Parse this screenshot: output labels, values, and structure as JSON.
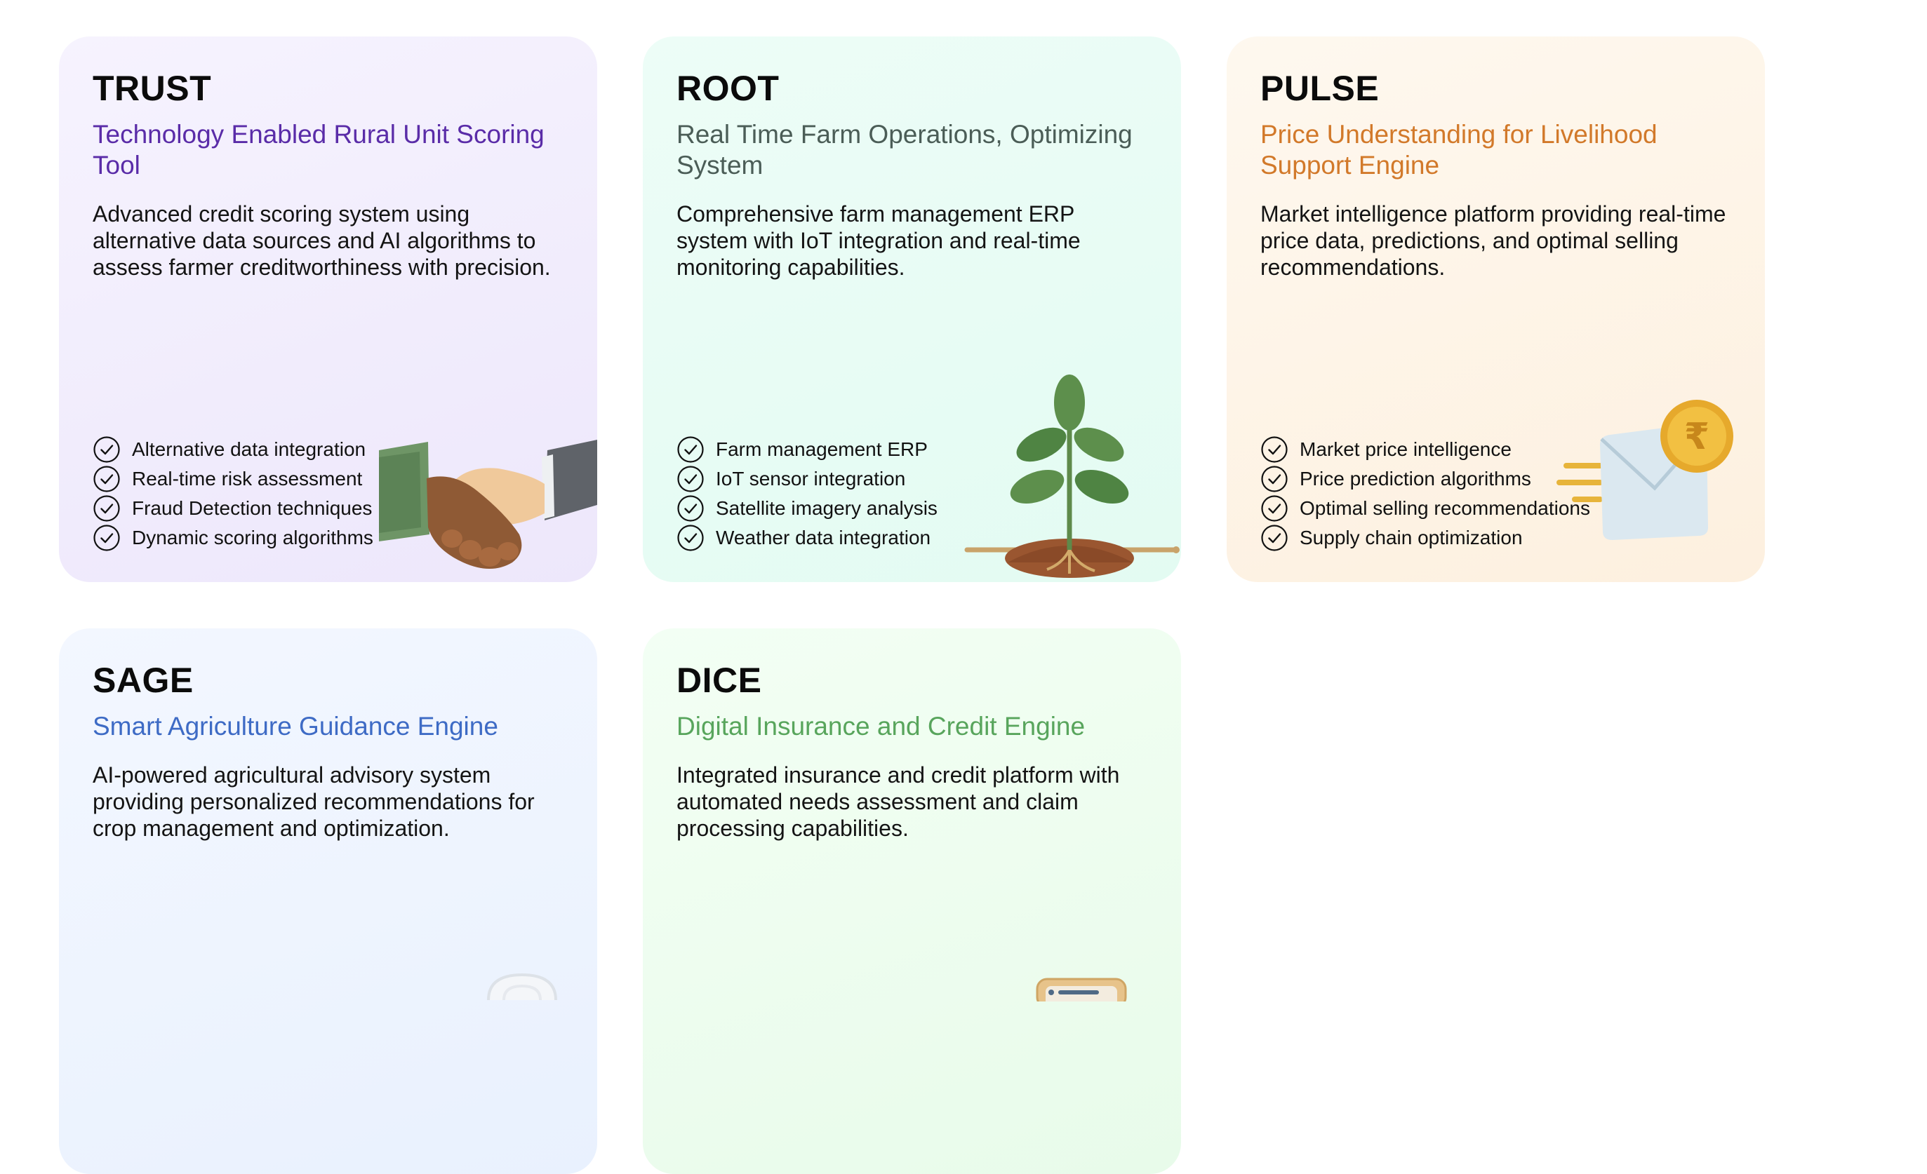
{
  "cards": [
    {
      "title": "TRUST",
      "subtitle": "Technology Enabled Rural Unit Scoring Tool",
      "subtitle_color": "#5a2ca8",
      "description": "Advanced credit scoring system using alternative data sources and AI algorithms to assess farmer creditworthiness with precision.",
      "features": [
        "Alternative data integration",
        "Real-time risk assessment",
        "Fraud Detection techniques",
        "Dynamic scoring algorithms"
      ],
      "icon": "handshake-icon"
    },
    {
      "title": "ROOT",
      "subtitle": "Real Time Farm Operations, Optimizing System",
      "subtitle_color": "#4b5d57",
      "description": "Comprehensive farm management ERP system with IoT integration and real-time monitoring capabilities.",
      "features": [
        "Farm management ERP",
        "IoT sensor integration",
        "Satellite imagery analysis",
        "Weather data integration"
      ],
      "icon": "sprout-icon"
    },
    {
      "title": "PULSE",
      "subtitle": "Price Understanding for Livelihood Support Engine",
      "subtitle_color": "#d2792a",
      "description": "Market intelligence platform providing real-time price data, predictions, and optimal selling recommendations.",
      "features": [
        "Market price intelligence",
        "Price prediction algorithms",
        "Optimal selling recommendations",
        "Supply chain optimization"
      ],
      "icon": "rupee-envelope-icon"
    },
    {
      "title": "SAGE",
      "subtitle": "Smart Agriculture Guidance Engine",
      "subtitle_color": "#3e6bc5",
      "description": "AI-powered agricultural advisory system providing personalized recommendations for crop management and optimization.",
      "icon": "advisor-icon"
    },
    {
      "title": "DICE",
      "subtitle": "Digital Insurance and Credit Engine",
      "subtitle_color": "#58a55c",
      "description": "Integrated insurance and credit platform with automated needs assessment and claim processing capabilities.",
      "icon": "document-icon"
    }
  ]
}
